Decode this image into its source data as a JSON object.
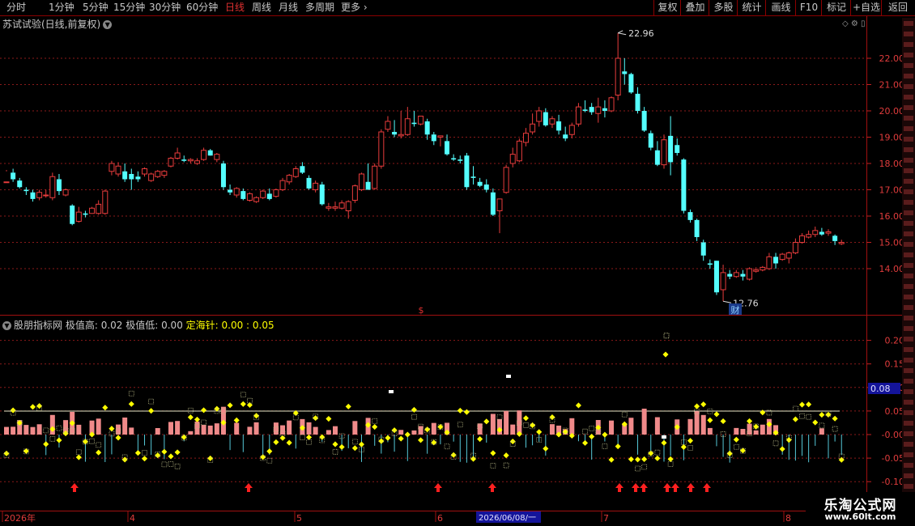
{
  "toolbar": {
    "periods": [
      "分时",
      "1分钟",
      "5分钟",
      "15分钟",
      "30分钟",
      "60分钟",
      "日线",
      "周线",
      "月线",
      "多周期",
      "更多"
    ],
    "active_period": "日线",
    "right_buttons": [
      "复权",
      "叠加",
      "多股",
      "统计",
      "画线",
      "F10",
      "标记",
      "+自选",
      "返回"
    ]
  },
  "main_panel": {
    "title": "苏试试验(日线,前复权)",
    "high_label": "22.96",
    "low_label": "12.76",
    "cai_badge": "财",
    "s_marker": "$",
    "price_axis": [
      "22.00",
      "21.00",
      "20.00",
      "19.00",
      "18.00",
      "17.00",
      "16.00",
      "15.00",
      "14.00"
    ]
  },
  "indicator_panel": {
    "name": "股朋指标网",
    "high_text": "极值高: 0.02",
    "low_text": "极值低: 0.00",
    "dhz_text": "定海针: 0.00 : 0.05",
    "current_value": "0.08",
    "axis": [
      "0.20",
      "0.15",
      "0.10",
      "0.05",
      "-0.00",
      "-0.05",
      "-0.10"
    ]
  },
  "date_axis": {
    "labels": [
      "2026年",
      "4",
      "5",
      "6",
      "7",
      "8"
    ],
    "cursor_date": "2026/06/08/一"
  },
  "watermark": {
    "name": "乐淘公式网",
    "url": "www.60lt.com"
  },
  "colors": {
    "up": "#e83c3c",
    "down": "#54ffff",
    "grid": "#8b1a1a",
    "yellow": "#ffff00",
    "indicator_up": "#f08a8a",
    "indicator_green": "#22cc22"
  },
  "chart_data": {
    "type": "candlestick",
    "title": "苏试试验(日线,前复权)",
    "ylim": [
      12.5,
      23.5
    ],
    "highest": 22.96,
    "lowest": 12.76,
    "ohlc": [
      [
        17.3,
        17.75,
        17.7,
        17.3
      ],
      [
        17.65,
        17.8,
        17.3,
        17.4
      ],
      [
        17.35,
        17.45,
        17.05,
        17.1
      ],
      [
        17.0,
        17.1,
        16.8,
        16.95
      ],
      [
        16.9,
        17.0,
        16.55,
        16.65
      ],
      [
        16.7,
        17.0,
        16.6,
        16.9
      ],
      [
        16.8,
        17.0,
        16.7,
        16.8
      ],
      [
        16.7,
        17.65,
        16.6,
        17.5
      ],
      [
        17.4,
        17.6,
        16.8,
        16.95
      ],
      [
        16.8,
        17.05,
        16.75,
        17.0
      ],
      [
        16.4,
        16.45,
        15.65,
        15.7
      ],
      [
        15.8,
        16.35,
        15.75,
        16.15
      ],
      [
        16.1,
        16.2,
        15.95,
        16.05
      ],
      [
        16.1,
        16.35,
        16.1,
        16.3
      ],
      [
        16.1,
        16.6,
        16.05,
        16.45
      ],
      [
        16.1,
        17.0,
        16.05,
        16.95
      ],
      [
        17.7,
        18.1,
        17.55,
        18.0
      ],
      [
        17.6,
        18.05,
        17.5,
        17.9
      ],
      [
        17.7,
        18.0,
        17.3,
        17.4
      ],
      [
        17.6,
        17.8,
        17.0,
        17.4
      ],
      [
        17.5,
        17.7,
        17.3,
        17.4
      ],
      [
        17.6,
        17.85,
        17.5,
        17.8
      ],
      [
        17.35,
        17.65,
        17.3,
        17.6
      ],
      [
        17.5,
        17.75,
        17.45,
        17.7
      ],
      [
        17.55,
        17.75,
        17.45,
        17.7
      ],
      [
        17.9,
        18.25,
        17.85,
        18.2
      ],
      [
        18.2,
        18.6,
        18.15,
        18.4
      ],
      [
        18.15,
        18.3,
        18.05,
        18.1
      ],
      [
        18.1,
        18.2,
        18.0,
        18.15
      ],
      [
        18.0,
        18.2,
        17.95,
        18.1
      ],
      [
        18.15,
        18.6,
        18.1,
        18.5
      ],
      [
        18.5,
        18.55,
        18.3,
        18.3
      ],
      [
        18.15,
        18.4,
        18.05,
        18.35
      ],
      [
        18.0,
        18.1,
        17.0,
        17.1
      ],
      [
        17.0,
        17.2,
        16.8,
        16.9
      ],
      [
        16.8,
        17.1,
        16.7,
        17.05
      ],
      [
        16.95,
        17.05,
        16.6,
        16.65
      ],
      [
        16.6,
        16.9,
        16.55,
        16.85
      ],
      [
        16.55,
        16.75,
        16.5,
        16.7
      ],
      [
        16.7,
        17.0,
        16.65,
        16.95
      ],
      [
        16.85,
        17.05,
        16.6,
        16.65
      ],
      [
        16.75,
        17.05,
        16.7,
        17.0
      ],
      [
        17.0,
        17.45,
        16.95,
        17.35
      ],
      [
        17.3,
        17.6,
        17.2,
        17.55
      ],
      [
        17.5,
        17.9,
        17.45,
        17.8
      ],
      [
        17.9,
        18.05,
        17.6,
        17.65
      ],
      [
        17.45,
        17.55,
        17.0,
        17.05
      ],
      [
        17.0,
        17.35,
        16.9,
        17.25
      ],
      [
        17.2,
        17.3,
        16.4,
        16.45
      ],
      [
        16.3,
        16.5,
        16.2,
        16.35
      ],
      [
        16.3,
        16.55,
        16.2,
        16.35
      ],
      [
        16.3,
        16.6,
        16.25,
        16.5
      ],
      [
        16.2,
        16.6,
        15.9,
        16.55
      ],
      [
        16.6,
        17.2,
        16.5,
        17.15
      ],
      [
        17.0,
        17.65,
        16.95,
        17.6
      ],
      [
        17.3,
        18.0,
        17.2,
        17.0
      ],
      [
        17.05,
        18.0,
        17.0,
        17.9
      ],
      [
        17.9,
        19.3,
        17.8,
        19.2
      ],
      [
        19.3,
        19.8,
        19.2,
        19.6
      ],
      [
        19.2,
        19.65,
        19.0,
        19.1
      ],
      [
        19.05,
        20.0,
        18.95,
        19.1
      ],
      [
        19.1,
        20.15,
        19.05,
        19.7
      ],
      [
        19.55,
        20.0,
        19.4,
        19.5
      ],
      [
        19.5,
        19.8,
        19.45,
        19.8
      ],
      [
        19.6,
        19.7,
        18.9,
        19.1
      ],
      [
        19.1,
        19.2,
        18.7,
        18.85
      ],
      [
        19.0,
        19.05,
        18.65,
        19.05
      ],
      [
        18.85,
        19.1,
        18.3,
        18.35
      ],
      [
        18.2,
        18.35,
        18.1,
        18.15
      ],
      [
        18.15,
        18.3,
        18.0,
        18.1
      ],
      [
        18.3,
        18.4,
        17.0,
        17.1
      ],
      [
        17.5,
        17.9,
        17.2,
        17.45
      ],
      [
        17.3,
        17.45,
        17.1,
        17.15
      ],
      [
        17.2,
        17.4,
        16.9,
        17.0
      ],
      [
        16.9,
        17.05,
        16.0,
        16.05
      ],
      [
        16.2,
        16.6,
        15.35,
        16.65
      ],
      [
        16.9,
        17.95,
        16.85,
        17.85
      ],
      [
        18.0,
        18.6,
        17.85,
        18.35
      ],
      [
        18.1,
        18.95,
        18.05,
        18.85
      ],
      [
        18.8,
        19.35,
        18.65,
        19.15
      ],
      [
        19.2,
        19.9,
        19.1,
        19.5
      ],
      [
        19.6,
        20.15,
        19.4,
        20.0
      ],
      [
        19.95,
        20.1,
        19.4,
        19.45
      ],
      [
        19.5,
        19.8,
        19.35,
        19.7
      ],
      [
        19.6,
        19.85,
        19.1,
        19.25
      ],
      [
        19.1,
        19.4,
        18.85,
        18.95
      ],
      [
        19.1,
        19.55,
        18.95,
        19.45
      ],
      [
        19.5,
        20.3,
        19.4,
        20.15
      ],
      [
        20.05,
        20.4,
        19.95,
        20.0
      ],
      [
        20.15,
        20.3,
        19.85,
        19.95
      ],
      [
        19.9,
        20.5,
        19.55,
        20.15
      ],
      [
        20.1,
        20.4,
        19.75,
        20.0
      ],
      [
        20.0,
        20.55,
        19.95,
        20.5
      ],
      [
        20.6,
        22.96,
        20.4,
        22.0
      ],
      [
        21.5,
        22.0,
        21.0,
        21.4
      ],
      [
        21.4,
        21.45,
        20.65,
        20.7
      ],
      [
        20.65,
        20.9,
        19.9,
        20.0
      ],
      [
        20.0,
        20.15,
        19.2,
        19.25
      ],
      [
        19.15,
        19.25,
        18.5,
        18.6
      ],
      [
        18.5,
        18.85,
        17.9,
        17.95
      ],
      [
        17.95,
        19.1,
        17.8,
        18.9
      ],
      [
        19.05,
        19.8,
        17.55,
        18.05
      ],
      [
        18.7,
        18.95,
        18.3,
        18.4
      ],
      [
        18.15,
        18.2,
        16.1,
        16.2
      ],
      [
        16.15,
        16.25,
        15.75,
        15.85
      ],
      [
        15.85,
        15.9,
        15.05,
        15.2
      ],
      [
        15.0,
        15.1,
        14.3,
        14.5
      ],
      [
        14.2,
        14.35,
        14.0,
        14.15
      ],
      [
        14.3,
        14.3,
        13.0,
        13.1
      ],
      [
        13.2,
        14.15,
        12.76,
        13.85
      ],
      [
        13.8,
        13.95,
        13.6,
        13.7
      ],
      [
        13.7,
        13.95,
        13.65,
        13.85
      ],
      [
        13.8,
        13.95,
        13.55,
        13.7
      ],
      [
        13.6,
        14.05,
        13.55,
        14.0
      ],
      [
        13.9,
        14.05,
        13.85,
        13.95
      ],
      [
        13.95,
        14.1,
        13.9,
        14.05
      ],
      [
        14.0,
        14.6,
        13.95,
        14.45
      ],
      [
        14.45,
        14.6,
        14.0,
        14.2
      ],
      [
        14.35,
        14.6,
        14.3,
        14.55
      ],
      [
        14.4,
        14.65,
        14.2,
        14.6
      ],
      [
        14.6,
        15.15,
        14.55,
        15.0
      ],
      [
        15.0,
        15.35,
        14.95,
        15.25
      ],
      [
        15.2,
        15.45,
        15.15,
        15.3
      ],
      [
        15.3,
        15.6,
        15.2,
        15.45
      ],
      [
        15.4,
        15.55,
        15.25,
        15.3
      ],
      [
        15.35,
        15.5,
        15.25,
        15.4
      ],
      [
        15.25,
        15.3,
        14.9,
        15.05
      ],
      [
        14.95,
        15.1,
        14.9,
        15.0
      ]
    ],
    "indicator_ylim": [
      -0.12,
      0.24
    ]
  }
}
